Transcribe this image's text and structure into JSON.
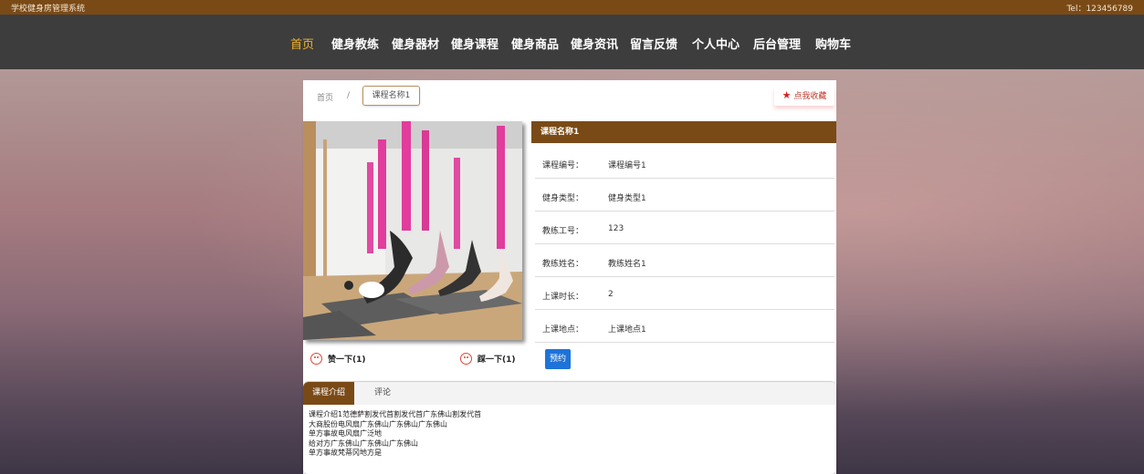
{
  "topbar": {
    "site_name": "学校健身房管理系统",
    "tel": "Tel：123456789"
  },
  "nav": {
    "items": [
      {
        "label": "首页",
        "active": true
      },
      {
        "label": "健身教练"
      },
      {
        "label": "健身器材"
      },
      {
        "label": "健身课程"
      },
      {
        "label": "健身商品"
      },
      {
        "label": "健身资讯"
      },
      {
        "label": "留言反馈"
      },
      {
        "label": "个人中心"
      },
      {
        "label": "后台管理"
      },
      {
        "label": "购物车"
      }
    ]
  },
  "breadcrumb": {
    "home": "首页",
    "sep": "/",
    "current": "课程名称1"
  },
  "favorite": {
    "label": "点我收藏",
    "icon": "star-icon"
  },
  "reactions": {
    "like": "赞一下(1)",
    "dislike": "踩一下(1)"
  },
  "detail": {
    "title": "课程名称1",
    "rows": [
      {
        "key": "课程编号：",
        "value": "课程编号1"
      },
      {
        "key": "健身类型：",
        "value": "健身类型1"
      },
      {
        "key": "教练工号：",
        "value": "123"
      },
      {
        "key": "教练姓名：",
        "value": "教练姓名1"
      },
      {
        "key": "上课时长：",
        "value": "2"
      },
      {
        "key": "上课地点：",
        "value": "上课地点1"
      }
    ],
    "book_label": "预约"
  },
  "tabs": {
    "items": [
      "课程介绍",
      "评论"
    ],
    "description_lines": [
      "课程介绍1范德萨割发代首割发代首广东佛山割发代首",
      "大商股份电风扇广东佛山广东佛山广东佛山",
      "单方事故电风扇广泛地",
      "给对方广东佛山广东佛山广东佛山",
      "单方事故梵蒂冈地方是"
    ]
  },
  "colors": {
    "brand": "#7a4a16",
    "nav_active": "#f0b429",
    "button": "#1e73d8"
  }
}
